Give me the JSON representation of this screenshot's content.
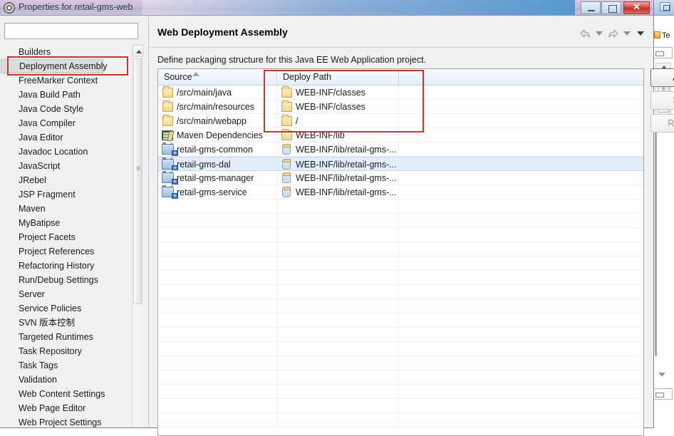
{
  "window": {
    "title": "Properties for retail-gms-web",
    "icon": "gear-icon",
    "buttons": {
      "minimize": "minimize",
      "maximize": "maximize",
      "close": "close"
    }
  },
  "left_pane": {
    "filter": {
      "value": "",
      "placeholder": ""
    },
    "selected_item": "Deployment Assembly",
    "items": [
      {
        "label": "Builders"
      },
      {
        "label": "Deployment Assembly"
      },
      {
        "label": "FreeMarker Context"
      },
      {
        "label": "Java Build Path"
      },
      {
        "label": "Java Code Style"
      },
      {
        "label": "Java Compiler"
      },
      {
        "label": "Java Editor"
      },
      {
        "label": "Javadoc Location"
      },
      {
        "label": "JavaScript"
      },
      {
        "label": "JRebel"
      },
      {
        "label": "JSP Fragment"
      },
      {
        "label": "Maven"
      },
      {
        "label": "MyBatipse"
      },
      {
        "label": "Project Facets"
      },
      {
        "label": "Project References"
      },
      {
        "label": "Refactoring History"
      },
      {
        "label": "Run/Debug Settings"
      },
      {
        "label": "Server"
      },
      {
        "label": "Service Policies"
      },
      {
        "label": "SVN 版本控制"
      },
      {
        "label": "Targeted Runtimes"
      },
      {
        "label": "Task Repository"
      },
      {
        "label": "Task Tags"
      },
      {
        "label": "Validation"
      },
      {
        "label": "Web Content Settings"
      },
      {
        "label": "Web Page Editor"
      },
      {
        "label": "Web Project Settings"
      }
    ]
  },
  "right_pane": {
    "page_title": "Web Deployment Assembly",
    "description": "Define packaging structure for this Java EE Web Application project.",
    "nav": {
      "back": "back-arrow",
      "back_menu": "chevron-down",
      "forward": "forward-arrow",
      "forward_menu": "chevron-down",
      "view_menu": "chevron-down"
    },
    "table": {
      "columns": [
        "Source",
        "Deploy Path",
        ""
      ],
      "sort_column": "Source",
      "sort_direction": "ascending",
      "rows": [
        {
          "source": "/src/main/java",
          "source_icon": "folder-icon",
          "deploy": "WEB-INF/classes",
          "deploy_icon": "folder-icon",
          "selected": false
        },
        {
          "source": "/src/main/resources",
          "source_icon": "folder-icon",
          "deploy": "WEB-INF/classes",
          "deploy_icon": "folder-icon",
          "selected": false
        },
        {
          "source": "/src/main/webapp",
          "source_icon": "folder-icon",
          "deploy": "/",
          "deploy_icon": "folder-icon",
          "selected": false
        },
        {
          "source": "Maven Dependencies",
          "source_icon": "maven-icon",
          "deploy": "WEB-INF/lib",
          "deploy_icon": "folder-icon",
          "selected": false
        },
        {
          "source": "retail-gms-common",
          "source_icon": "project-icon",
          "deploy": "WEB-INF/lib/retail-gms-...",
          "deploy_icon": "jar-icon",
          "selected": false
        },
        {
          "source": "retail-gms-dal",
          "source_icon": "project-icon",
          "deploy": "WEB-INF/lib/retail-gms-...",
          "deploy_icon": "jar-icon",
          "selected": true
        },
        {
          "source": "retail-gms-manager",
          "source_icon": "project-icon",
          "deploy": "WEB-INF/lib/retail-gms-...",
          "deploy_icon": "jar-icon",
          "selected": false
        },
        {
          "source": "retail-gms-service",
          "source_icon": "project-icon",
          "deploy": "WEB-INF/lib/retail-gms-...",
          "deploy_icon": "jar-icon",
          "selected": false
        }
      ],
      "empty_rows": 16
    },
    "buttons": {
      "add": "Add...",
      "edit": "Edit...",
      "remove": "Remove"
    }
  },
  "background_window": {
    "tab_label": "Te"
  },
  "annotations": {
    "accent_color": "#c0392b",
    "boxes": [
      "deployment-assembly-sidebar-item",
      "deploy-path-column-rows"
    ]
  }
}
